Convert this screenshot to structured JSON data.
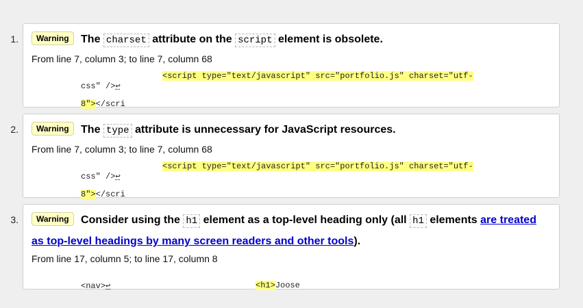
{
  "messages": [
    {
      "number": "1.",
      "badge": "Warning",
      "title_pre": "The",
      "code1": "charset",
      "title_mid": "attribute on the",
      "code2": "script",
      "title_post": "element is obsolete.",
      "location": "From line 7, column 3; to line 7, column 68",
      "extract_pre": "css\" />",
      "arrow": "↩",
      "extract_hl_1": "<script type=\"text/javascript\" src=\"portfolio.js\" charset=\"utf-",
      "extract_hl_2": "8\">",
      "extract_post": "</scri"
    },
    {
      "number": "2.",
      "badge": "Warning",
      "title_pre": "The",
      "code1": "type",
      "title_post": "attribute is unnecessary for JavaScript resources.",
      "location": "From line 7, column 3; to line 7, column 68",
      "extract_pre": "css\" />",
      "arrow": "↩",
      "extract_hl_1": "<script type=\"text/javascript\" src=\"portfolio.js\" charset=\"utf-",
      "extract_hl_2": "8\">",
      "extract_post": "</scri"
    },
    {
      "number": "3.",
      "badge": "Warning",
      "title_pre": "Consider using the",
      "code1": "h1",
      "title_mid": "element as a top-level heading only (all",
      "code2": "h1",
      "title_mid2": "elements",
      "link_1": "are treated",
      "link_2": "as top-level headings by many screen readers and other tools",
      "title_end": ").",
      "location": "From line 17, column 5; to line 17, column 8",
      "extract_pre": "<nav>",
      "arrow": "↩",
      "extract_hl_1": "<h1>",
      "extract_post": "Joose"
    }
  ]
}
